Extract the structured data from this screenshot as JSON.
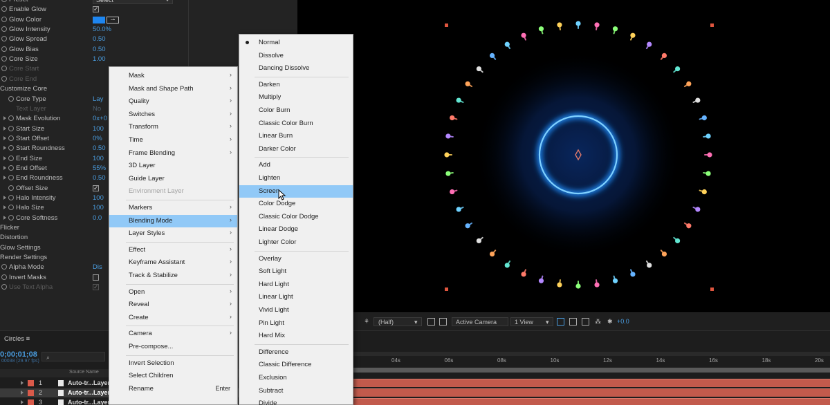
{
  "effect_controls": {
    "rows": [
      {
        "id": "preset",
        "label": "Preset",
        "type": "dropdown",
        "value": "Select",
        "stopwatch": true
      },
      {
        "id": "enable-glow",
        "label": "Enable Glow",
        "type": "checkbox",
        "checked": true,
        "stopwatch": true
      },
      {
        "id": "glow-color",
        "label": "Glow Color",
        "type": "color",
        "color": "#1e86f0",
        "stopwatch": true
      },
      {
        "id": "glow-intensity",
        "label": "Glow Intensity",
        "value": "50.0%",
        "stopwatch": true
      },
      {
        "id": "glow-spread",
        "label": "Glow Spread",
        "value": "0.50",
        "stopwatch": true
      },
      {
        "id": "glow-bias",
        "label": "Glow Bias",
        "value": "0.50",
        "stopwatch": true
      },
      {
        "id": "core-size",
        "label": "Core Size",
        "value": "1.00",
        "stopwatch": true
      },
      {
        "id": "core-start",
        "label": "Core Start",
        "disabled": true,
        "stopwatch": true
      },
      {
        "id": "core-end",
        "label": "Core End",
        "disabled": true,
        "stopwatch": true
      },
      {
        "id": "customize-core",
        "label": "Customize Core",
        "section": true
      },
      {
        "id": "core-type",
        "label": "Core Type",
        "value": "Lay",
        "stopwatch": true,
        "indent": 1
      },
      {
        "id": "text-layer",
        "label": "Text Layer",
        "disabled": true,
        "value": "No",
        "indent": 1
      },
      {
        "id": "mask-evolution",
        "label": "Mask Evolution",
        "value": "0x+0",
        "stopwatch": true,
        "twirl": true,
        "indent": 1
      },
      {
        "id": "start-size",
        "label": "Start Size",
        "value": "100",
        "stopwatch": true,
        "twirl": true,
        "indent": 1
      },
      {
        "id": "start-offset",
        "label": "Start Offset",
        "value": "0%",
        "stopwatch": true,
        "twirl": true,
        "indent": 1
      },
      {
        "id": "start-roundness",
        "label": "Start Roundness",
        "value": "0.50",
        "stopwatch": true,
        "twirl": true,
        "indent": 1
      },
      {
        "id": "end-size",
        "label": "End Size",
        "value": "100",
        "stopwatch": true,
        "twirl": true,
        "indent": 1
      },
      {
        "id": "end-offset",
        "label": "End Offset",
        "value": "55%",
        "stopwatch": true,
        "twirl": true,
        "indent": 1
      },
      {
        "id": "end-roundness",
        "label": "End Roundness",
        "value": "0.50",
        "stopwatch": true,
        "twirl": true,
        "indent": 1
      },
      {
        "id": "offset-size",
        "label": "Offset Size",
        "type": "checkbox",
        "checked": true,
        "stopwatch": true,
        "indent": 1
      },
      {
        "id": "halo-intensity",
        "label": "Halo Intensity",
        "value": "100",
        "stopwatch": true,
        "twirl": true,
        "indent": 1
      },
      {
        "id": "halo-size",
        "label": "Halo Size",
        "value": "100",
        "stopwatch": true,
        "twirl": true,
        "indent": 1
      },
      {
        "id": "core-softness",
        "label": "Core Softness",
        "value": "0.0",
        "stopwatch": true,
        "twirl": true,
        "indent": 1
      },
      {
        "id": "flicker",
        "label": "Flicker",
        "section": true
      },
      {
        "id": "distortion",
        "label": "Distortion",
        "section": true
      },
      {
        "id": "glow-settings",
        "label": "Glow Settings",
        "section": true
      },
      {
        "id": "render-settings",
        "label": "Render Settings",
        "section": true
      },
      {
        "id": "alpha-mode",
        "label": "Alpha Mode",
        "value": "Dis",
        "stopwatch": true
      },
      {
        "id": "invert-masks",
        "label": "Invert Masks",
        "type": "checkbox",
        "checked": false,
        "stopwatch": true
      },
      {
        "id": "use-text-alpha",
        "label": "Use Text Alpha",
        "type": "checkbox",
        "checked": true,
        "disabled": true,
        "stopwatch": true
      }
    ]
  },
  "context_menu": {
    "items": [
      {
        "label": "Mask",
        "submenu": true
      },
      {
        "label": "Mask and Shape Path",
        "submenu": true
      },
      {
        "label": "Quality",
        "submenu": true
      },
      {
        "label": "Switches",
        "submenu": true
      },
      {
        "label": "Transform",
        "submenu": true
      },
      {
        "label": "Time",
        "submenu": true
      },
      {
        "label": "Frame Blending",
        "submenu": true
      },
      {
        "label": "3D Layer"
      },
      {
        "label": "Guide Layer"
      },
      {
        "label": "Environment Layer",
        "disabled": true
      },
      {
        "sep": true
      },
      {
        "label": "Markers",
        "submenu": true
      },
      {
        "label": "Blending Mode",
        "submenu": true,
        "highlighted": true
      },
      {
        "label": "Layer Styles",
        "submenu": true
      },
      {
        "sep": true
      },
      {
        "label": "Effect",
        "submenu": true
      },
      {
        "label": "Keyframe Assistant",
        "submenu": true
      },
      {
        "label": "Track & Stabilize",
        "submenu": true
      },
      {
        "sep": true
      },
      {
        "label": "Open",
        "submenu": true
      },
      {
        "label": "Reveal",
        "submenu": true
      },
      {
        "label": "Create",
        "submenu": true
      },
      {
        "sep": true
      },
      {
        "label": "Camera",
        "submenu": true
      },
      {
        "label": "Pre-compose..."
      },
      {
        "sep": true
      },
      {
        "label": "Invert Selection"
      },
      {
        "label": "Select Children"
      },
      {
        "label": "Rename",
        "shortcut": "Enter"
      }
    ]
  },
  "blending_menu": {
    "items": [
      {
        "label": "Normal",
        "checked": true
      },
      {
        "label": "Dissolve"
      },
      {
        "label": "Dancing Dissolve"
      },
      {
        "sep": true
      },
      {
        "label": "Darken"
      },
      {
        "label": "Multiply"
      },
      {
        "label": "Color Burn"
      },
      {
        "label": "Classic Color Burn"
      },
      {
        "label": "Linear Burn"
      },
      {
        "label": "Darker Color"
      },
      {
        "sep": true
      },
      {
        "label": "Add"
      },
      {
        "label": "Lighten"
      },
      {
        "label": "Screen",
        "highlighted": true
      },
      {
        "label": "Color Dodge"
      },
      {
        "label": "Classic Color Dodge"
      },
      {
        "label": "Linear Dodge"
      },
      {
        "label": "Lighter Color"
      },
      {
        "sep": true
      },
      {
        "label": "Overlay"
      },
      {
        "label": "Soft Light"
      },
      {
        "label": "Hard Light"
      },
      {
        "label": "Linear Light"
      },
      {
        "label": "Vivid Light"
      },
      {
        "label": "Pin Light"
      },
      {
        "label": "Hard Mix"
      },
      {
        "sep": true
      },
      {
        "label": "Difference"
      },
      {
        "label": "Classic Difference"
      },
      {
        "label": "Exclusion"
      },
      {
        "label": "Subtract"
      },
      {
        "label": "Divide"
      }
    ]
  },
  "viewer_bar": {
    "resolution": "(Half)",
    "camera": "Active Camera",
    "views": "1 View",
    "exposure": "+0.0"
  },
  "timeline": {
    "comp_tab": "Circles",
    "current_time": "0;00;01;08",
    "frame_info": "00038 (29.97 fps)",
    "source_name_header": "Source Name",
    "ticks": [
      "04s",
      "06s",
      "08s",
      "10s",
      "12s",
      "14s",
      "16s",
      "18s",
      "20s"
    ],
    "layers": [
      {
        "num": "1",
        "name": "Auto-tr...Layer 1"
      },
      {
        "num": "2",
        "name": "Auto-tr...Layer 1",
        "selected": true
      },
      {
        "num": "3",
        "name": "Auto-tr...Layer 1"
      }
    ]
  },
  "colors": {
    "accent": "#4a9de0",
    "glow": "#1e86f0",
    "menu_highlight": "#91c9f7",
    "layer_label": "#d95a4a"
  }
}
